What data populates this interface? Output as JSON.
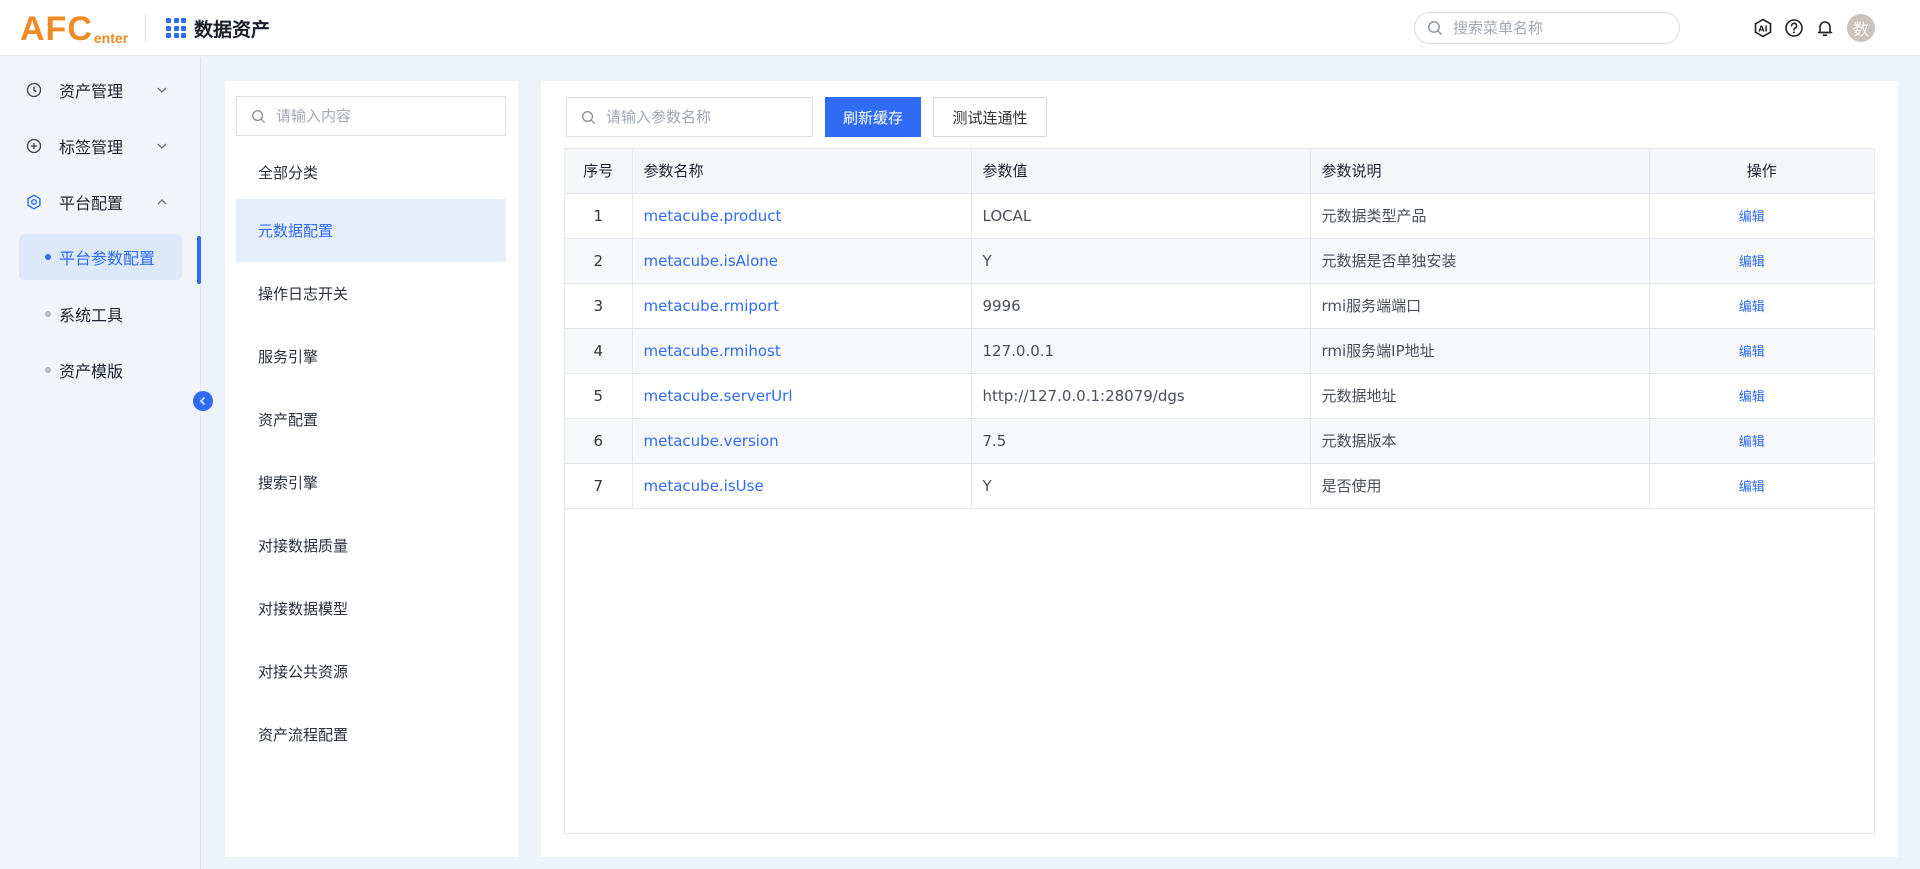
{
  "header": {
    "logo_main": "AFC",
    "logo_sub": "enter",
    "app_title": "数据资产",
    "search_placeholder": "搜索菜单名称",
    "avatar_text": "数"
  },
  "sidebar": {
    "groups": [
      {
        "label": "资产管理",
        "icon": "clock-icon",
        "expanded": false
      },
      {
        "label": "标签管理",
        "icon": "plus-circle-icon",
        "expanded": false
      },
      {
        "label": "平台配置",
        "icon": "gear-icon",
        "expanded": true
      }
    ],
    "sub_items": [
      {
        "label": "平台参数配置",
        "active": true
      },
      {
        "label": "系统工具",
        "active": false
      },
      {
        "label": "资产模版",
        "active": false
      }
    ]
  },
  "categories": {
    "search_placeholder": "请输入内容",
    "items": [
      {
        "label": "全部分类"
      },
      {
        "label": "元数据配置",
        "active": true
      },
      {
        "label": "操作日志开关"
      },
      {
        "label": "服务引擎"
      },
      {
        "label": "资产配置"
      },
      {
        "label": "搜索引擎"
      },
      {
        "label": "对接数据质量"
      },
      {
        "label": "对接数据模型"
      },
      {
        "label": "对接公共资源"
      },
      {
        "label": "资产流程配置"
      }
    ]
  },
  "main": {
    "search_placeholder": "请输入参数名称",
    "refresh_button": "刷新缓存",
    "test_button": "测试连通性",
    "table": {
      "columns": [
        "序号",
        "参数名称",
        "参数值",
        "参数说明",
        "操作"
      ],
      "rows": [
        {
          "idx": "1",
          "name": "metacube.product",
          "value": "LOCAL",
          "desc": "元数据类型产品",
          "op": "编辑"
        },
        {
          "idx": "2",
          "name": "metacube.isAlone",
          "value": "Y",
          "desc": "元数据是否单独安装",
          "op": "编辑"
        },
        {
          "idx": "3",
          "name": "metacube.rmiport",
          "value": "9996",
          "desc": "rmi服务端端口",
          "op": "编辑"
        },
        {
          "idx": "4",
          "name": "metacube.rmihost",
          "value": "127.0.0.1",
          "desc": "rmi服务端IP地址",
          "op": "编辑"
        },
        {
          "idx": "5",
          "name": "metacube.serverUrl",
          "value": "http://127.0.0.1:28079/dgs",
          "desc": "元数据地址",
          "op": "编辑"
        },
        {
          "idx": "6",
          "name": "metacube.version",
          "value": "7.5",
          "desc": "元数据版本",
          "op": "编辑"
        },
        {
          "idx": "7",
          "name": "metacube.isUse",
          "value": "Y",
          "desc": "是否使用",
          "op": "编辑"
        }
      ]
    }
  },
  "colors": {
    "primary": "#2f6bf5",
    "logo": "#f08a24"
  }
}
